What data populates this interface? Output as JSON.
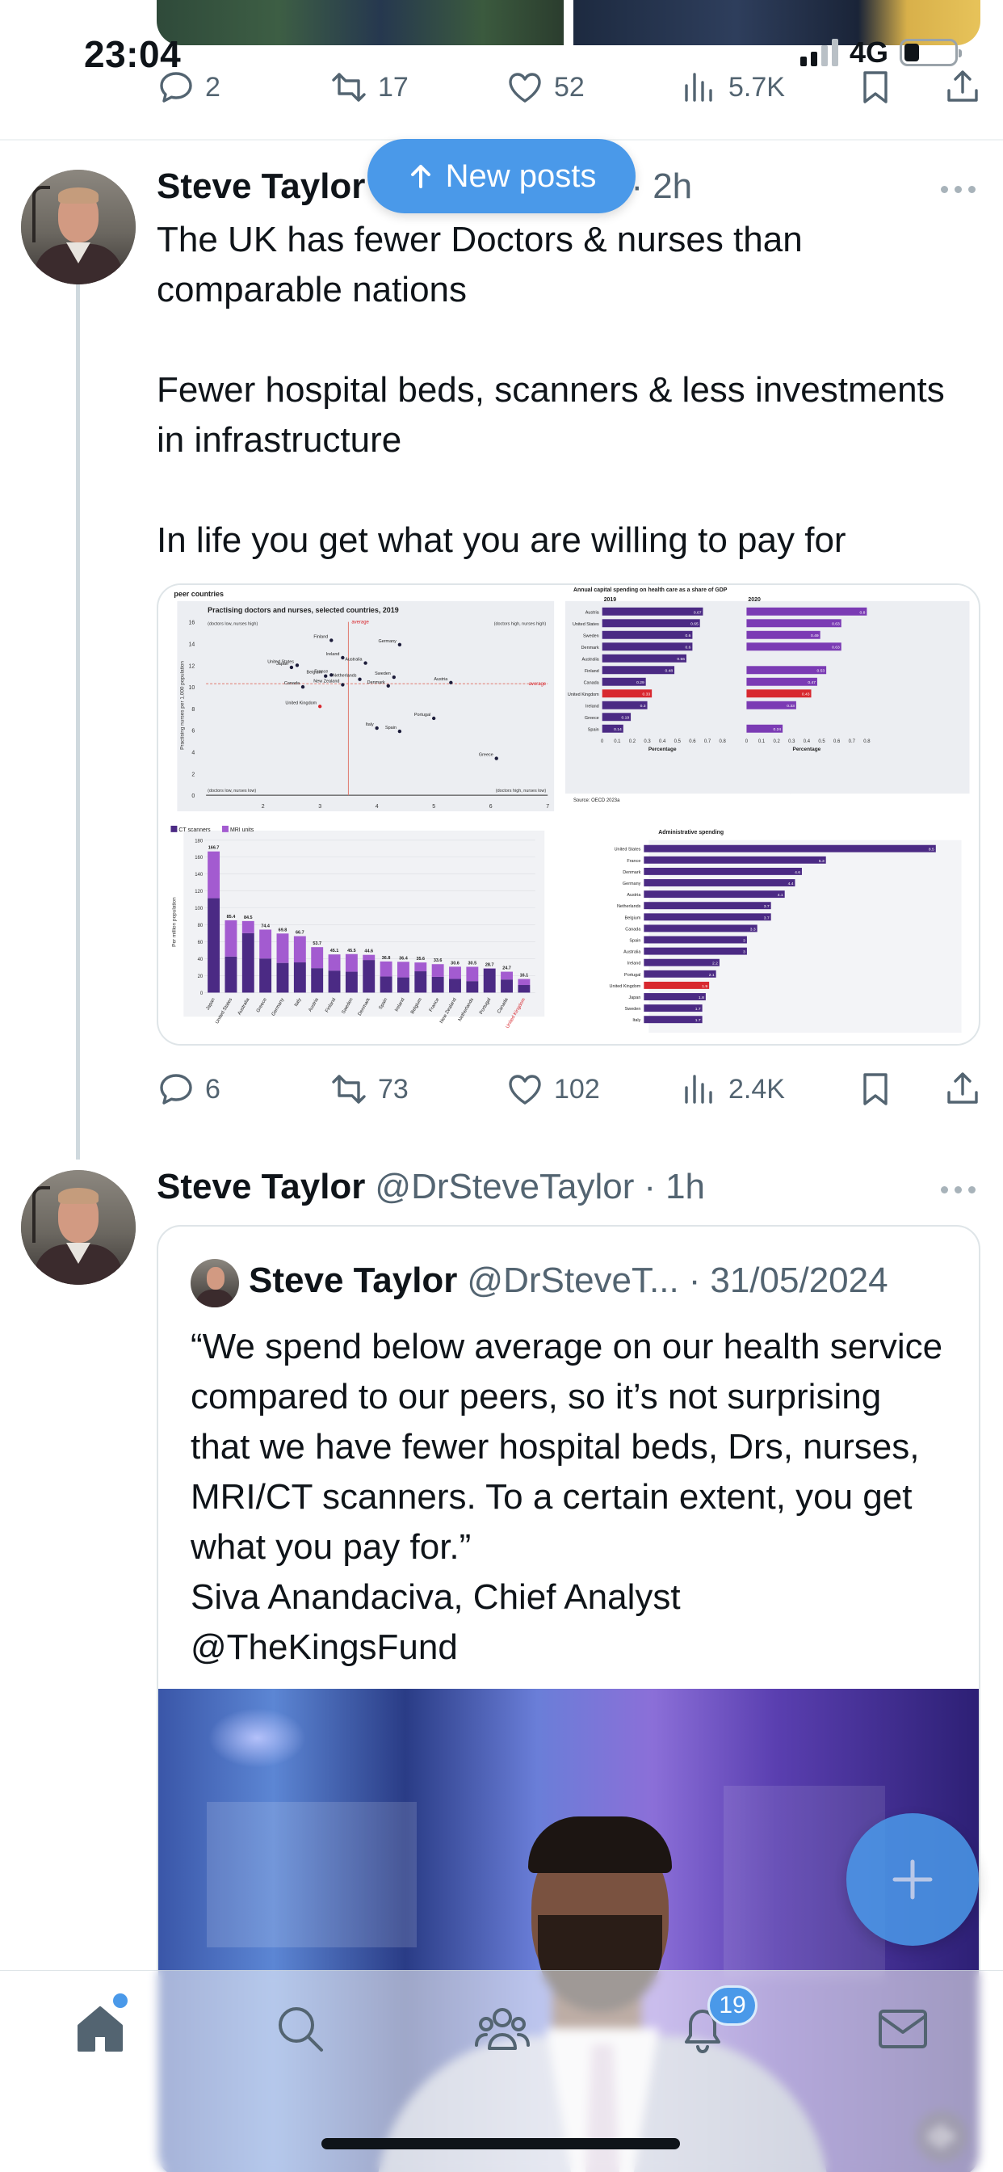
{
  "status_bar": {
    "time": "23:04",
    "network": "4G"
  },
  "prev_tweet": {
    "actions": {
      "replies": "2",
      "reposts": "17",
      "likes": "52",
      "views": "5.7K"
    }
  },
  "new_posts_label": "New posts",
  "tweet1": {
    "author": "Steve Taylor",
    "handle_partial": "or",
    "separator": "·",
    "time": "2h",
    "text": "The UK has fewer Doctors & nurses than comparable nations\n\nFewer hospital beds, scanners & less investments in infrastructure\n\nIn life you get what you are willing to pay for",
    "actions": {
      "replies": "6",
      "reposts": "73",
      "likes": "102",
      "views": "2.4K"
    }
  },
  "embedded_charts": {
    "panel1": {
      "header": "peer countries",
      "title": "Practising doctors and nurses, selected countries, 2019",
      "ylabel": "Practising nurses per 1,000 population",
      "avg_label": "average",
      "corner_tl": "(doctors low, nurses high)",
      "corner_tr": "(doctors high, nurses high)",
      "corner_bl": "(doctors low, nurses low)",
      "corner_br": "(doctors high, nurses low)"
    },
    "panel2": {
      "title": "Annual capital spending on health care as a share of GDP",
      "year_a": "2019",
      "year_b": "2020",
      "xlabel": "Percentage",
      "source": "Source: OECD 2023a"
    },
    "panel3": {
      "legend_a": "CT scanners",
      "legend_b": "MRI units",
      "ylabel": "Per million population"
    },
    "panel4": {
      "title": "Administrative spending"
    }
  },
  "chart_data": [
    {
      "type": "scatter",
      "title": "Practising doctors and nurses, selected countries, 2019",
      "ylabel": "Practising nurses per 1,000 population",
      "xlim": [
        1,
        7
      ],
      "ylim": [
        0,
        16
      ],
      "points": [
        {
          "label": "France",
          "x": 3.2,
          "y": 11.1
        },
        {
          "label": "Belgium",
          "x": 3.1,
          "y": 11.0
        },
        {
          "label": "Finland",
          "x": 3.2,
          "y": 14.3
        },
        {
          "label": "Ireland",
          "x": 3.4,
          "y": 12.7
        },
        {
          "label": "United States",
          "x": 2.6,
          "y": 12.0
        },
        {
          "label": "Japan",
          "x": 2.5,
          "y": 11.8
        },
        {
          "label": "Australia",
          "x": 3.8,
          "y": 12.2
        },
        {
          "label": "Germany",
          "x": 4.4,
          "y": 13.9
        },
        {
          "label": "Sweden",
          "x": 4.3,
          "y": 10.9
        },
        {
          "label": "Canada",
          "x": 2.7,
          "y": 10.0
        },
        {
          "label": "New Zealand",
          "x": 3.4,
          "y": 10.2
        },
        {
          "label": "Denmark",
          "x": 4.2,
          "y": 10.1
        },
        {
          "label": "Austria",
          "x": 5.3,
          "y": 10.4
        },
        {
          "label": "Netherlands",
          "x": 3.7,
          "y": 10.7
        },
        {
          "label": "United Kingdom",
          "x": 3.0,
          "y": 8.2
        },
        {
          "label": "Portugal",
          "x": 5.0,
          "y": 7.1
        },
        {
          "label": "Italy",
          "x": 4.0,
          "y": 6.2
        },
        {
          "label": "Spain",
          "x": 4.4,
          "y": 5.9
        },
        {
          "label": "Greece",
          "x": 6.1,
          "y": 3.4
        }
      ]
    },
    {
      "type": "bar",
      "title": "Annual capital spending on health care as a share of GDP",
      "categories": [
        "Austria",
        "United States",
        "Sweden",
        "Denmark",
        "Australia",
        "Finland",
        "Canada",
        "United Kingdom",
        "Ireland",
        "Greece",
        "Spain"
      ],
      "series": [
        {
          "name": "2019",
          "values": [
            0.67,
            0.65,
            0.6,
            0.6,
            0.56,
            0.48,
            0.29,
            0.33,
            0.3,
            0.19,
            0.14
          ]
        },
        {
          "name": "2020",
          "values": [
            0.8,
            0.63,
            0.49,
            0.63,
            0.0,
            0.53,
            0.47,
            0.43,
            0.33,
            0.0,
            0.24
          ]
        }
      ],
      "xlabel": "Percentage",
      "xlim": [
        0,
        0.8
      ]
    },
    {
      "type": "bar",
      "categories": [
        "Japan",
        "United States",
        "Australia",
        "Greece",
        "Germany",
        "Italy",
        "Austria",
        "Finland",
        "Sweden",
        "Denmark",
        "Spain",
        "Ireland",
        "Belgium",
        "France",
        "New Zealand",
        "Netherlands",
        "Portugal",
        "Canada",
        "United Kingdom"
      ],
      "series": [
        {
          "name": "CT scanners",
          "values": [
            111.5,
            42.6,
            70.2,
            40.3,
            35.1,
            35.7,
            28.9,
            26.0,
            24.7,
            38.5,
            19.1,
            18.0,
            25.2,
            18.6,
            16.2,
            13.6,
            28.4,
            15.5,
            9.0
          ]
        },
        {
          "name": "MRI units",
          "values": [
            55.2,
            42.8,
            14.3,
            34.1,
            34.7,
            31.0,
            24.8,
            19.1,
            20.8,
            6.1,
            17.7,
            18.4,
            10.4,
            15.0,
            14.4,
            16.9,
            0.3,
            9.2,
            7.1
          ]
        }
      ],
      "data_labels": [
        "166.7",
        "85.4",
        "84.5",
        "74.4",
        "69.8",
        "66.7",
        "53.7",
        "45.1",
        "45.5",
        "44.6",
        "36.8",
        "36.4",
        "35.6",
        "33.6",
        "30.6",
        "30.5",
        "28.7",
        "24.7",
        "16.1"
      ],
      "ylabel": "Per million population",
      "ylim": [
        0,
        180
      ]
    },
    {
      "type": "bar",
      "title": "Administrative spending",
      "categories": [
        "United States",
        "France",
        "Denmark",
        "Germany",
        "Austria",
        "Netherlands",
        "Belgium",
        "Canada",
        "Spain",
        "Australia",
        "Ireland",
        "Portugal",
        "United Kingdom",
        "Japan",
        "Sweden",
        "Italy"
      ],
      "values": [
        8.5,
        5.3,
        4.6,
        4.4,
        4.1,
        3.7,
        3.7,
        3.3,
        3.0,
        3.0,
        2.2,
        2.1,
        1.9,
        1.8,
        1.7,
        1.7
      ]
    }
  ],
  "tweet2": {
    "author": "Steve Taylor",
    "handle": "@DrSteveTaylor",
    "separator": "·",
    "time": "1h",
    "quote": {
      "author": "Steve Taylor",
      "handle": "@DrSteveT...",
      "separator": "·",
      "date": "31/05/2024",
      "text": "“We spend below average on our health service compared to our peers, so it’s not surprising that we have fewer hospital beds, Drs, nurses, MRI/CT scanners. To a certain extent, you get what you pay for.”\nSiva Anandaciva, Chief Analyst @TheKingsFund"
    }
  },
  "bottom_nav": {
    "notification_count": "19"
  },
  "colors": {
    "accent": "#4a99e9",
    "text": "#0f1419",
    "muted": "#536471",
    "divider": "#eff3f4",
    "chart_purple": "#4b2a84",
    "chart_violet": "#a35bd0",
    "chart_red": "#d8282f"
  }
}
